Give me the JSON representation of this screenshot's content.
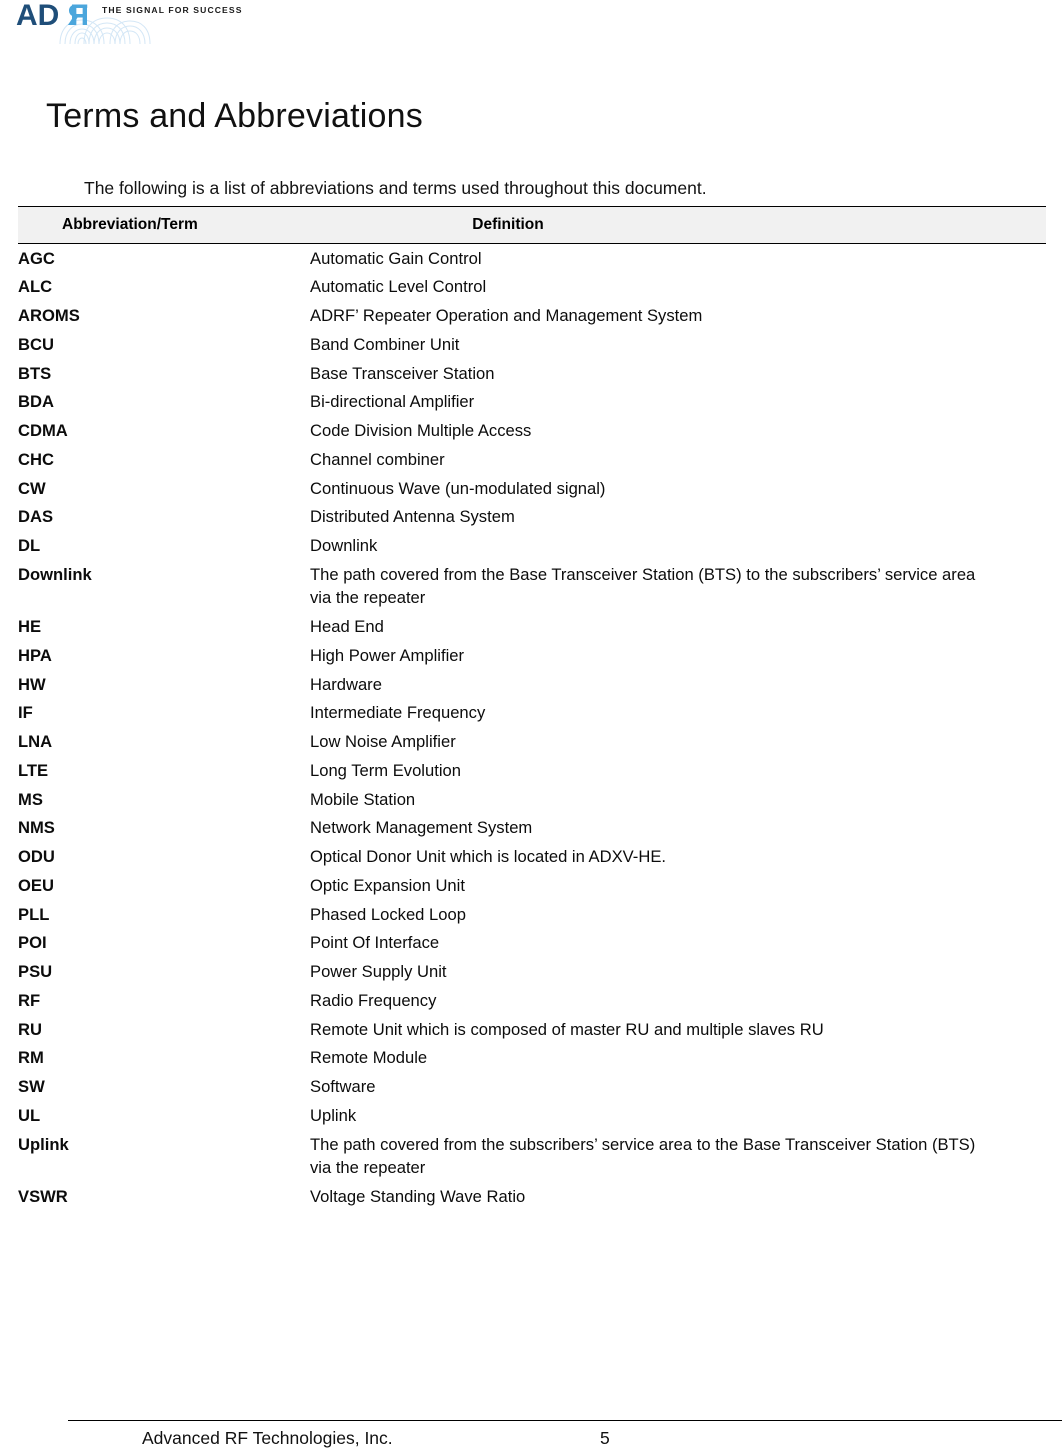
{
  "header": {
    "logo_text_dark": "AD",
    "logo_text_light": "RF",
    "logo_tagline": "THE SIGNAL FOR SUCCESS",
    "logo_color_dark": "#1F4E79",
    "logo_color_light": "#4BA6DC",
    "logo_wave_color": "#CFE4F4"
  },
  "title": "Terms and Abbreviations",
  "intro": "The following is a list of abbreviations and terms used throughout this document.",
  "table": {
    "headers": {
      "term": "Abbreviation/Term",
      "definition": "Definition"
    },
    "header_bg": "#F1F1F1",
    "rows": [
      {
        "term": "AGC",
        "definition": "Automatic Gain Control"
      },
      {
        "term": "ALC",
        "definition": "Automatic Level Control"
      },
      {
        "term": "AROMS",
        "definition": "ADRF’ Repeater Operation and Management System"
      },
      {
        "term": "BCU",
        "definition": "Band Combiner Unit"
      },
      {
        "term": "BTS",
        "definition": "Base Transceiver Station"
      },
      {
        "term": "BDA",
        "definition": "Bi-directional Amplifier"
      },
      {
        "term": "CDMA",
        "definition": "Code Division Multiple Access"
      },
      {
        "term": "CHC",
        "definition": "Channel combiner"
      },
      {
        "term": "CW",
        "definition": "Continuous Wave (un-modulated signal)"
      },
      {
        "term": "DAS",
        "definition": "Distributed Antenna System"
      },
      {
        "term": "DL",
        "definition": "Downlink"
      },
      {
        "term": "Downlink",
        "definition": "The path covered from the Base Transceiver Station (BTS) to the subscribers’ service area",
        "definition_line2": "via the repeater"
      },
      {
        "term": "HE",
        "definition": "Head End"
      },
      {
        "term": "HPA",
        "definition": "High Power Amplifier"
      },
      {
        "term": "HW",
        "definition": "Hardware"
      },
      {
        "term": "IF",
        "definition": "Intermediate Frequency"
      },
      {
        "term": "LNA",
        "definition": "Low Noise Amplifier"
      },
      {
        "term": "LTE",
        "definition": "Long Term Evolution"
      },
      {
        "term": "MS",
        "definition": "Mobile Station"
      },
      {
        "term": "NMS",
        "definition": "Network Management System"
      },
      {
        "term": "ODU",
        "definition": "Optical Donor Unit which is located in ADXV-HE."
      },
      {
        "term": "OEU",
        "definition": "Optic Expansion Unit"
      },
      {
        "term": "PLL",
        "definition": "Phased Locked Loop"
      },
      {
        "term": "POI",
        "definition": "Point Of Interface"
      },
      {
        "term": "PSU",
        "definition": "Power Supply Unit"
      },
      {
        "term": "RF",
        "definition": "Radio Frequency"
      },
      {
        "term": "RU",
        "definition": "Remote Unit which is composed of master RU and multiple slaves RU"
      },
      {
        "term": "RM",
        "definition": "Remote Module"
      },
      {
        "term": "SW",
        "definition": "Software"
      },
      {
        "term": "UL",
        "definition": "Uplink"
      },
      {
        "term": "Uplink",
        "definition": "The path covered from the subscribers’ service area to the Base Transceiver Station (BTS)",
        "definition_line2": "via the repeater"
      },
      {
        "term": "VSWR",
        "definition": "Voltage Standing Wave Ratio"
      }
    ]
  },
  "footer": {
    "company": "Advanced RF Technologies, Inc.",
    "page_number": "5"
  }
}
